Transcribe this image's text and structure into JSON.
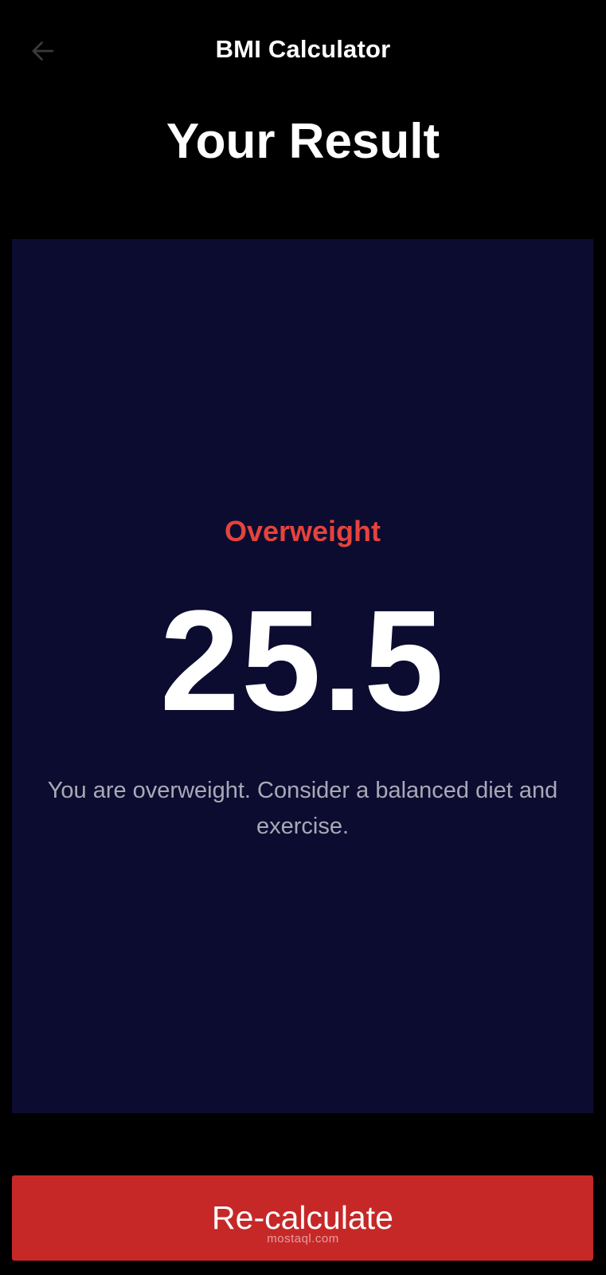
{
  "app_bar": {
    "title": "BMI Calculator",
    "back_icon": "arrow-left-icon"
  },
  "page": {
    "title": "Your Result"
  },
  "result": {
    "status": "Overweight",
    "bmi_value": "25.5",
    "message": "You are overweight. Consider a balanced diet and exercise."
  },
  "actions": {
    "recalculate_label": "Re-calculate"
  },
  "watermark": {
    "text": "mostaql.com"
  },
  "colors": {
    "background": "#000000",
    "card": "#0c0c31",
    "status": "#e5433b",
    "button": "#c62828",
    "message_text": "#a9a9b6"
  }
}
